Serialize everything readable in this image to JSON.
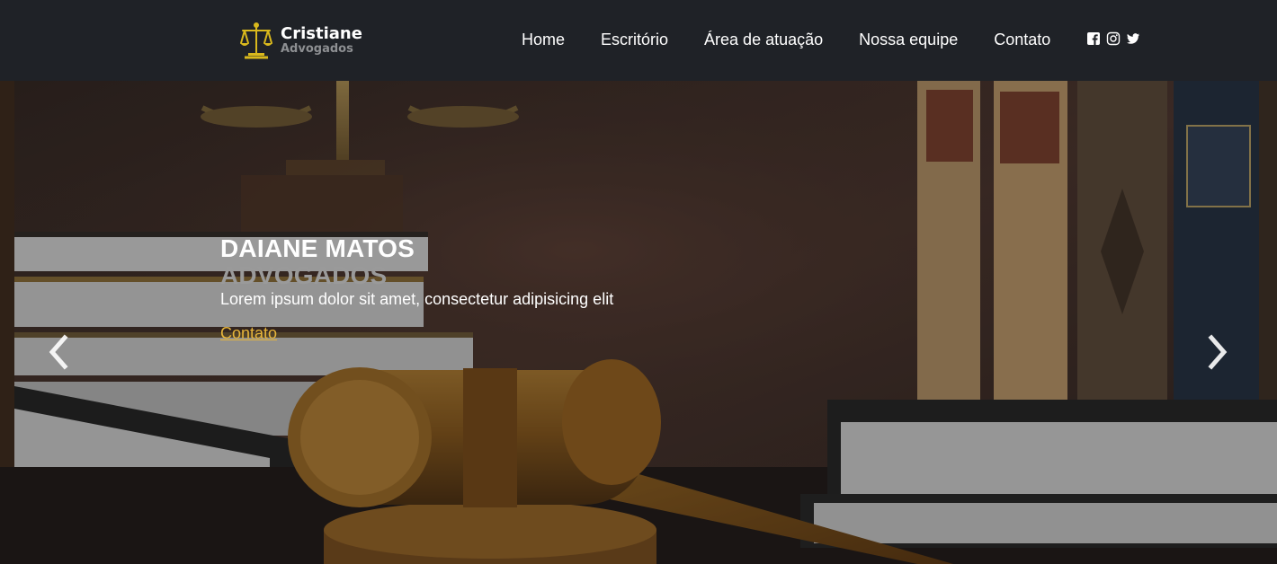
{
  "brand": {
    "name": "Cristiane",
    "sub": "Advogados",
    "logo_icon": "scales-of-justice-icon"
  },
  "nav": {
    "items": [
      {
        "label": "Home"
      },
      {
        "label": "Escritório"
      },
      {
        "label": "Área de atuação"
      },
      {
        "label": "Nossa equipe"
      },
      {
        "label": "Contato"
      }
    ],
    "social": [
      "facebook-icon",
      "instagram-icon",
      "twitter-icon"
    ]
  },
  "hero": {
    "title": "DAIANE MATOS",
    "subtitle": "ADVOGADOS",
    "text": "Lorem ipsum dolor sit amet, consectetur adipisicing elit",
    "link_label": "Contato",
    "prev_icon": "chevron-left-icon",
    "next_icon": "chevron-right-icon"
  },
  "colors": {
    "navbar_bg": "#1f2227",
    "brand_gold": "#d9b91d",
    "link_gold": "#e7b53a",
    "subtitle_gray": "#9a9a9a"
  }
}
